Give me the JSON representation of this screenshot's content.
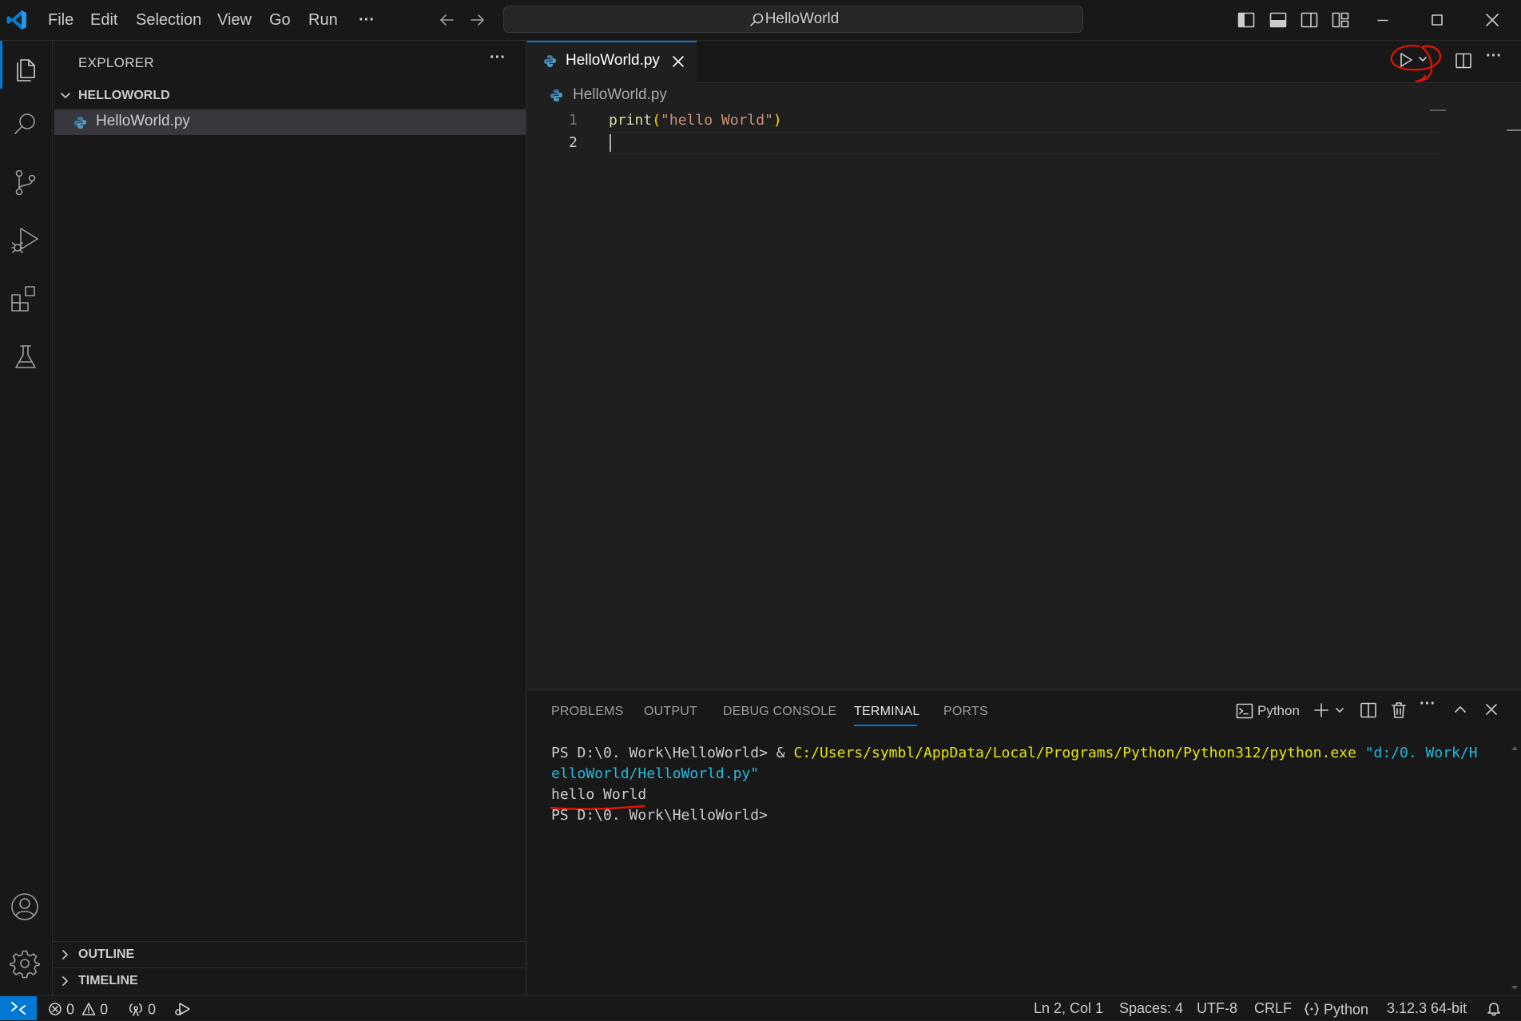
{
  "titlebar": {
    "menu": [
      "File",
      "Edit",
      "Selection",
      "View",
      "Go",
      "Run"
    ],
    "more": "···",
    "search_text": "HelloWorld"
  },
  "sidebar": {
    "header": "EXPLORER",
    "more": "···",
    "folder": "HELLOWORLD",
    "files": [
      "HelloWorld.py"
    ],
    "outline": "OUTLINE",
    "timeline": "TIMELINE"
  },
  "editor": {
    "tab_label": "HelloWorld.py",
    "breadcrumb": "HelloWorld.py",
    "line_numbers": [
      "1",
      "2"
    ],
    "code": {
      "fn": "print",
      "open": "(",
      "str": "\"hello World\"",
      "close": ")"
    }
  },
  "panel": {
    "tabs": [
      "PROBLEMS",
      "OUTPUT",
      "DEBUG CONSOLE",
      "TERMINAL",
      "PORTS"
    ],
    "active_tab": "TERMINAL",
    "terminal_profile": "Python",
    "terminal": {
      "prompt1": "PS D:\\0. Work\\HelloWorld> ",
      "amp": "& ",
      "exe": "C:/Users/symbl/AppData/Local/Programs/Python/Python312/python.exe",
      "arg_part1": " \"d:/0. Work/H",
      "arg_part2": "elloWorld/HelloWorld.py\"",
      "output": "hello World",
      "prompt2": "PS D:\\0. Work\\HelloWorld>"
    }
  },
  "statusbar": {
    "errors": "0",
    "warnings": "0",
    "ports": "0",
    "position": "Ln 2, Col 1",
    "spaces": "Spaces: 4",
    "encoding": "UTF-8",
    "eol": "CRLF",
    "language": "Python",
    "interpreter": "3.12.3 64-bit"
  },
  "colors": {
    "accent": "#0078d4",
    "remote": "#0078d4",
    "function": "#dcdcaa",
    "string": "#ce9178",
    "bracket": "#ffd700",
    "terminal_exe": "#e5e510",
    "terminal_arg": "#29b8db",
    "annotation": "#e51400"
  },
  "icons": [
    "vscode-logo",
    "files-icon",
    "search-icon",
    "source-control-icon",
    "run-debug-icon",
    "extensions-icon",
    "testing-icon",
    "account-icon",
    "manage-gear-icon",
    "python-file-icon",
    "run-python-file-icon",
    "split-editor-icon",
    "terminal-icon",
    "trash-icon",
    "bell-icon"
  ]
}
